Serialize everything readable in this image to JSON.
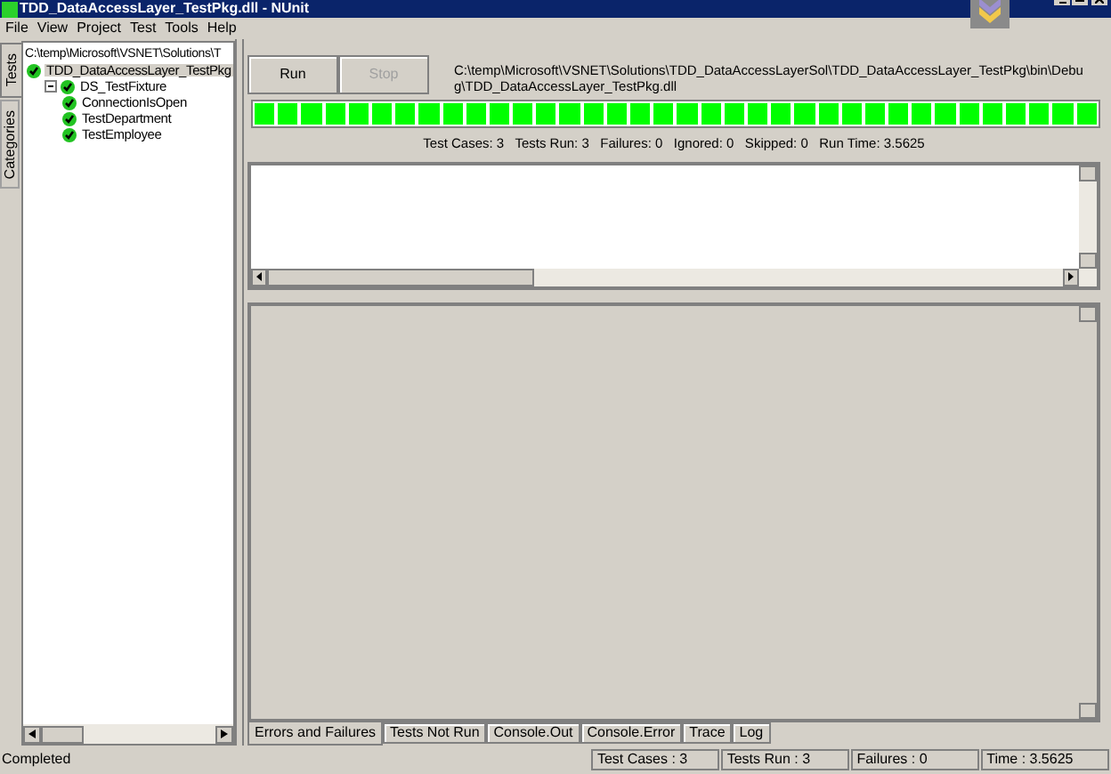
{
  "window": {
    "title": "TDD_DataAccessLayer_TestPkg.dll - NUnit"
  },
  "menu": [
    "File",
    "View",
    "Project",
    "Test",
    "Tools",
    "Help"
  ],
  "side_tabs": [
    {
      "label": "Tests",
      "selected": true
    },
    {
      "label": "Categories",
      "selected": false
    }
  ],
  "tree": {
    "path": "C:\\temp\\Microsoft\\VSNET\\Solutions\\T",
    "items": [
      {
        "label": "TDD_DataAccessLayer_TestPkg",
        "passed": true,
        "selected": true,
        "children": [
          {
            "label": "DS_TestFixture",
            "passed": true,
            "selected": false,
            "expanded": true,
            "children": [
              {
                "label": "ConnectionIsOpen",
                "passed": true,
                "selected": false
              },
              {
                "label": "TestDepartment",
                "passed": true,
                "selected": false
              },
              {
                "label": "TestEmployee",
                "passed": true,
                "selected": false
              }
            ]
          }
        ]
      }
    ]
  },
  "buttons": [
    {
      "label": "Run",
      "disabled": false
    },
    {
      "label": "Stop",
      "disabled": true
    }
  ],
  "assembly_path": "C:\\temp\\Microsoft\\VSNET\\Solutions\\TDD_DataAccessLayerSol\\TDD_DataAccessLayer_TestPkg\\bin\\Debug\\TDD_DataAccessLayer_TestPkg.dll",
  "progress": {
    "level": 1
  },
  "summary": "Test Cases: 3   Tests Run: 3   Failures: 0   Ignored: 0   Skipped: 0   Run Time: 3.5625",
  "result_tabs": [
    {
      "label": "Errors and Failures",
      "selected": true
    },
    {
      "label": "Tests Not Run",
      "selected": false
    },
    {
      "label": "Console.Out",
      "selected": false
    },
    {
      "label": "Console.Error",
      "selected": false
    },
    {
      "label": "Trace",
      "selected": false
    },
    {
      "label": "Log",
      "selected": false
    }
  ],
  "status_bar": {
    "message": "Completed",
    "panels": [
      "Test Cases : 3",
      "Tests Run : 3",
      "Failures : 0",
      "Time : 3.5625"
    ]
  }
}
